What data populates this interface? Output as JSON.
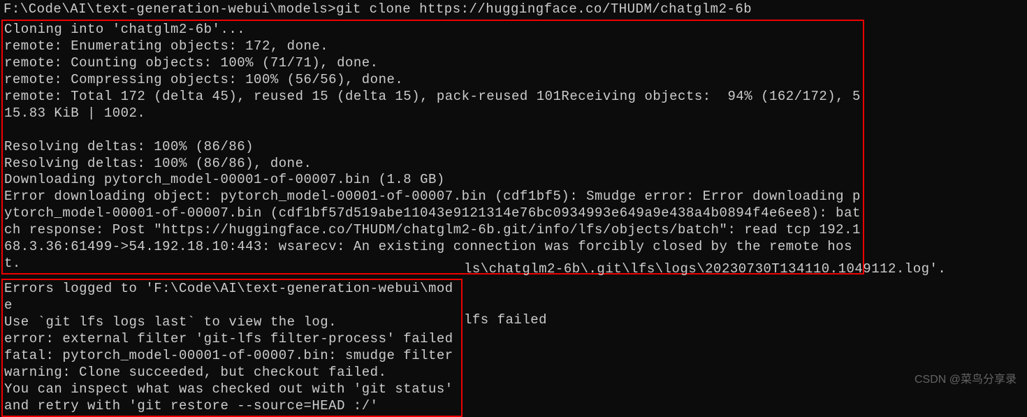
{
  "prompt": {
    "path": "F:\\Code\\AI\\text-generation-webui\\models>",
    "command": "git clone https://huggingface.co/THUDM/chatglm2-6b"
  },
  "box1": {
    "lines": [
      "Cloning into 'chatglm2-6b'...",
      "remote: Enumerating objects: 172, done.",
      "remote: Counting objects: 100% (71/71), done.",
      "remote: Compressing objects: 100% (56/56), done.",
      "remote: Total 172 (delta 45), reused 15 (delta 15), pack-reused 101Receiving objects:  94% (162/172), 515.83 KiB | 1002.",
      "",
      "Resolving deltas: 100% (86/86)",
      "Resolving deltas: 100% (86/86), done.",
      "Downloading pytorch_model-00001-of-00007.bin (1.8 GB)",
      "Error downloading object: pytorch_model-00001-of-00007.bin (cdf1bf5): Smudge error: Error downloading pytorch_model-00001-of-00007.bin (cdf1bf57d519abe11043e9121314e76bc0934993e649a9e438a4b0894f4e6ee8): batch response: Post \"https://huggingface.co/THUDM/chatglm2-6b.git/info/lfs/objects/batch\": read tcp 192.168.3.36:61499->54.192.18.10:443: wsarecv: An existing connection was forcibly closed by the remote host."
    ]
  },
  "box2": {
    "lines": [
      "Errors logged to 'F:\\Code\\AI\\text-generation-webui\\mode",
      "Use `git lfs logs last` to view the log.",
      "error: external filter 'git-lfs filter-process' failed",
      "fatal: pytorch_model-00001-of-00007.bin: smudge filter ",
      "warning: Clone succeeded, but checkout failed.",
      "You can inspect what was checked out with 'git status'",
      "and retry with 'git restore --source=HEAD :/'"
    ]
  },
  "overflow": {
    "line0": "ls\\chatglm2-6b\\.git\\lfs\\logs\\20230730T134110.1049112.log'.",
    "line3": "lfs failed"
  },
  "watermark": "CSDN @菜鸟分享录"
}
